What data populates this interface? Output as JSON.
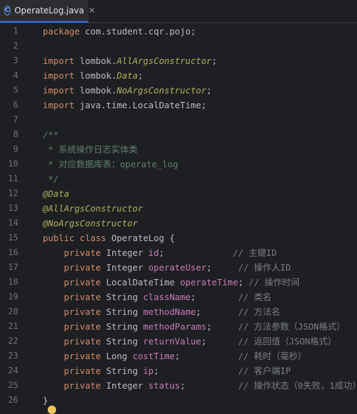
{
  "tab": {
    "icon": "C",
    "filename": "OperateLog.java",
    "close": "✕"
  },
  "lines": [
    {
      "n": "1",
      "parts": [
        {
          "c": "kw",
          "t": "package"
        },
        {
          "c": "plain",
          "t": " com.student.cqr.pojo;"
        }
      ]
    },
    {
      "n": "2",
      "parts": []
    },
    {
      "n": "3",
      "parts": [
        {
          "c": "kw",
          "t": "import"
        },
        {
          "c": "plain",
          "t": " lombok."
        },
        {
          "c": "ital",
          "t": "AllArgsConstructor"
        },
        {
          "c": "plain",
          "t": ";"
        }
      ]
    },
    {
      "n": "4",
      "parts": [
        {
          "c": "kw",
          "t": "import"
        },
        {
          "c": "plain",
          "t": " lombok."
        },
        {
          "c": "ital",
          "t": "Data"
        },
        {
          "c": "plain",
          "t": ";"
        }
      ]
    },
    {
      "n": "5",
      "parts": [
        {
          "c": "kw",
          "t": "import"
        },
        {
          "c": "plain",
          "t": " lombok."
        },
        {
          "c": "ital",
          "t": "NoArgsConstructor"
        },
        {
          "c": "plain",
          "t": ";"
        }
      ]
    },
    {
      "n": "6",
      "parts": [
        {
          "c": "kw",
          "t": "import"
        },
        {
          "c": "plain",
          "t": " java.time.LocalDateTime;"
        }
      ]
    },
    {
      "n": "7",
      "parts": []
    },
    {
      "n": "8",
      "parts": [
        {
          "c": "doc",
          "t": "/**"
        }
      ]
    },
    {
      "n": "9",
      "parts": [
        {
          "c": "doc",
          "t": " * "
        },
        {
          "c": "doc-txt",
          "t": "系统操作日志实体类"
        }
      ]
    },
    {
      "n": "10",
      "parts": [
        {
          "c": "doc",
          "t": " * "
        },
        {
          "c": "doc-txt",
          "t": "对应数据库表："
        },
        {
          "c": "doc",
          "t": "operate_log"
        }
      ]
    },
    {
      "n": "11",
      "parts": [
        {
          "c": "doc",
          "t": " */"
        }
      ]
    },
    {
      "n": "12",
      "parts": [
        {
          "c": "ann",
          "t": "@Data"
        }
      ]
    },
    {
      "n": "13",
      "parts": [
        {
          "c": "ann",
          "t": "@AllArgsConstructor"
        }
      ]
    },
    {
      "n": "14",
      "parts": [
        {
          "c": "ann",
          "t": "@NoArgsConstructor"
        }
      ]
    },
    {
      "n": "15",
      "parts": [
        {
          "c": "kw",
          "t": "public class"
        },
        {
          "c": "plain",
          "t": " OperateLog {"
        }
      ]
    },
    {
      "n": "16",
      "parts": [
        {
          "c": "kw",
          "t": "    private"
        },
        {
          "c": "type",
          "t": " Integer "
        },
        {
          "c": "field",
          "t": "id"
        },
        {
          "c": "plain",
          "t": ";             "
        },
        {
          "c": "cmt",
          "t": "// 主键ID"
        }
      ]
    },
    {
      "n": "17",
      "parts": [
        {
          "c": "kw",
          "t": "    private"
        },
        {
          "c": "type",
          "t": " Integer "
        },
        {
          "c": "field",
          "t": "operateUser"
        },
        {
          "c": "plain",
          "t": ";     "
        },
        {
          "c": "cmt",
          "t": "// 操作人ID"
        }
      ]
    },
    {
      "n": "18",
      "parts": [
        {
          "c": "kw",
          "t": "    private"
        },
        {
          "c": "type",
          "t": " LocalDateTime "
        },
        {
          "c": "field",
          "t": "operateTime"
        },
        {
          "c": "plain",
          "t": "; "
        },
        {
          "c": "cmt",
          "t": "// 操作时间"
        }
      ]
    },
    {
      "n": "19",
      "parts": [
        {
          "c": "kw",
          "t": "    private"
        },
        {
          "c": "type",
          "t": " String "
        },
        {
          "c": "field",
          "t": "className"
        },
        {
          "c": "plain",
          "t": ";        "
        },
        {
          "c": "cmt",
          "t": "// 类名"
        }
      ]
    },
    {
      "n": "20",
      "parts": [
        {
          "c": "kw",
          "t": "    private"
        },
        {
          "c": "type",
          "t": " String "
        },
        {
          "c": "field",
          "t": "methodName"
        },
        {
          "c": "plain",
          "t": ";       "
        },
        {
          "c": "cmt",
          "t": "// 方法名"
        }
      ]
    },
    {
      "n": "21",
      "parts": [
        {
          "c": "kw",
          "t": "    private"
        },
        {
          "c": "type",
          "t": " String "
        },
        {
          "c": "field",
          "t": "methodParams"
        },
        {
          "c": "plain",
          "t": ";     "
        },
        {
          "c": "cmt",
          "t": "// 方法参数（JSON格式）"
        }
      ]
    },
    {
      "n": "22",
      "parts": [
        {
          "c": "kw",
          "t": "    private"
        },
        {
          "c": "type",
          "t": " String "
        },
        {
          "c": "field",
          "t": "returnValue"
        },
        {
          "c": "plain",
          "t": ";      "
        },
        {
          "c": "cmt",
          "t": "// 返回值（JSON格式）"
        }
      ]
    },
    {
      "n": "23",
      "parts": [
        {
          "c": "kw",
          "t": "    private"
        },
        {
          "c": "type",
          "t": " Long "
        },
        {
          "c": "field",
          "t": "costTime"
        },
        {
          "c": "plain",
          "t": ";           "
        },
        {
          "c": "cmt",
          "t": "// 耗时（毫秒）"
        }
      ]
    },
    {
      "n": "24",
      "parts": [
        {
          "c": "kw",
          "t": "    private"
        },
        {
          "c": "type",
          "t": " String "
        },
        {
          "c": "field",
          "t": "ip"
        },
        {
          "c": "plain",
          "t": ";               "
        },
        {
          "c": "cmt",
          "t": "// 客户端IP"
        }
      ]
    },
    {
      "n": "25",
      "parts": [
        {
          "c": "kw",
          "t": "    private"
        },
        {
          "c": "type",
          "t": " Integer "
        },
        {
          "c": "field",
          "t": "status"
        },
        {
          "c": "plain",
          "t": ";          "
        },
        {
          "c": "cmt",
          "t": "// 操作状态（0失败，1成功）"
        }
      ]
    },
    {
      "n": "26",
      "parts": [
        {
          "c": "plain",
          "t": "}"
        }
      ]
    }
  ],
  "colors": {
    "keyword": "#cf8e6d",
    "annotation": "#b3ae60",
    "comment": "#7a7e85",
    "javadoc": "#5f826b",
    "field": "#c77dbb",
    "text": "#bcbec4",
    "accent": "#3574f0"
  },
  "icons": {
    "tab_icon": "class-icon",
    "intention": "lightbulb-icon"
  }
}
